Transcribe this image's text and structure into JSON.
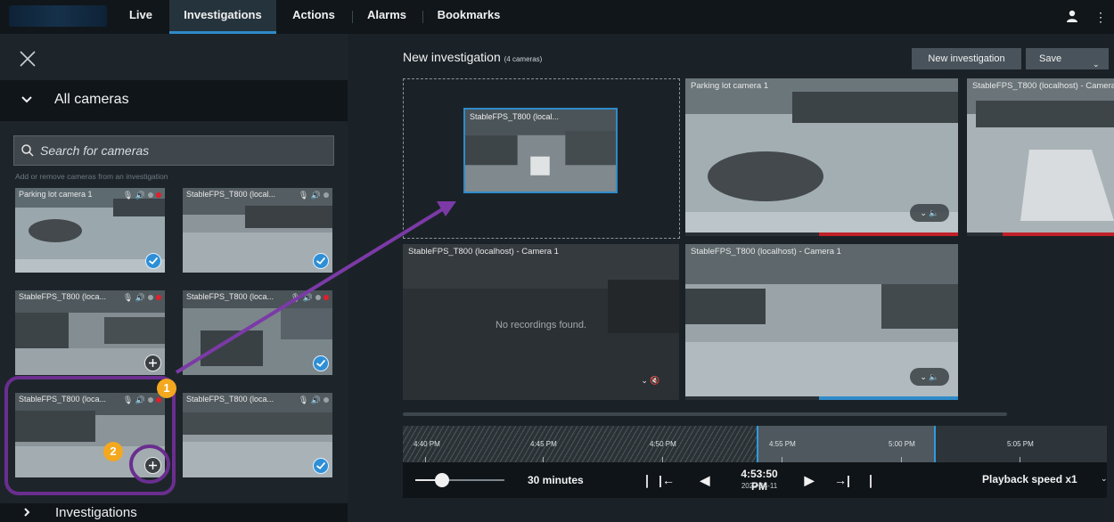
{
  "nav": {
    "tabs": [
      {
        "label": "Live"
      },
      {
        "label": "Investigations"
      },
      {
        "label": "Actions"
      },
      {
        "label": "Alarms"
      },
      {
        "label": "Bookmarks"
      }
    ],
    "active_tab": "Investigations",
    "accent_color": "#2f8bc9"
  },
  "left_panel": {
    "all_cameras_label": "All cameras",
    "search_placeholder": "Search for cameras",
    "hint": "Add or remove cameras from an investigation",
    "thumbnails": [
      {
        "label": "Parking lot camera 1",
        "selected": true
      },
      {
        "label": "StableFPS_T800 (local...",
        "selected": true
      },
      {
        "label": "StableFPS_T800 (loca...",
        "selected": false
      },
      {
        "label": "StableFPS_T800 (loca...",
        "selected": true
      },
      {
        "label": "StableFPS_T800 (loca...",
        "selected": false
      },
      {
        "label": "StableFPS_T800 (loca...",
        "selected": true
      }
    ],
    "investigations_label": "Investigations"
  },
  "main": {
    "title": "New investigation",
    "camera_count": "(4 cameras)",
    "new_investigation_button": "New investigation",
    "save_button": "Save",
    "drag_preview_label": "StableFPS_T800 (local...",
    "tiles": [
      {
        "title": "Parking lot camera 1"
      },
      {
        "title": "StableFPS_T800 (localhost) - Camera"
      },
      {
        "title": "StableFPS_T800 (localhost) - Camera 1",
        "message": "No recordings found."
      },
      {
        "title": "StableFPS_T800 (localhost) - Camera 1"
      }
    ]
  },
  "timeline": {
    "ticks": [
      "4:40 PM",
      "4:45 PM",
      "4:50 PM",
      "4:55 PM",
      "5:00 PM",
      "5:05 PM"
    ],
    "span": "30 minutes",
    "current_time": "4:53:50 PM",
    "current_date": "2022-04-11",
    "playback_speed": "Playback speed x1"
  },
  "annotations": {
    "step1": "1",
    "step2": "2",
    "highlight_color": "#6a2e8f",
    "badge_color": "#f3a81f"
  }
}
